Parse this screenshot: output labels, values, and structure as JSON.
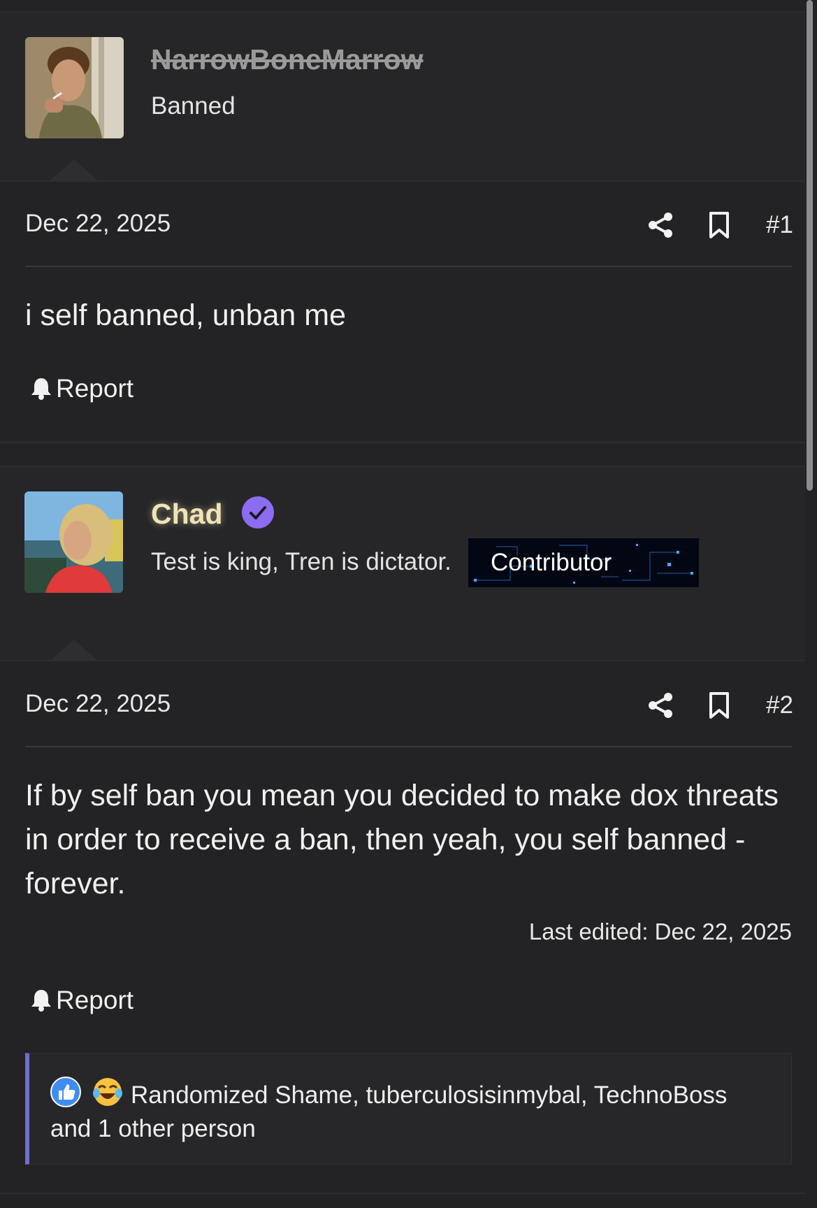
{
  "posts": [
    {
      "username": "NarrowBoneMarrow",
      "user_title": "Banned",
      "date": "Dec 22, 2025",
      "post_number": "#1",
      "body": "i self banned, unban me",
      "report_label": "Report"
    },
    {
      "username": "Chad",
      "user_title": "Test is king, Tren is dictator.",
      "badge": "Contributor",
      "date": "Dec 22, 2025",
      "post_number": "#2",
      "body": "If by self ban you mean you decided to make dox threats in order to receive a ban, then yeah, you self banned - forever.",
      "last_edited": "Last edited: Dec 22, 2025",
      "report_label": "Report",
      "reactions": {
        "icons": [
          "like-icon",
          "laugh-cry-icon"
        ],
        "text": "Randomized Shame, tuberculosisinmybal, TechnoBoss and 1 other person"
      }
    }
  ],
  "colors": {
    "background": "#232325",
    "banned_name": "#9a9a9a",
    "chad_name": "#efe3b8",
    "verified": "#8c6cf0",
    "reaction_bar": "#6f6fd0"
  }
}
